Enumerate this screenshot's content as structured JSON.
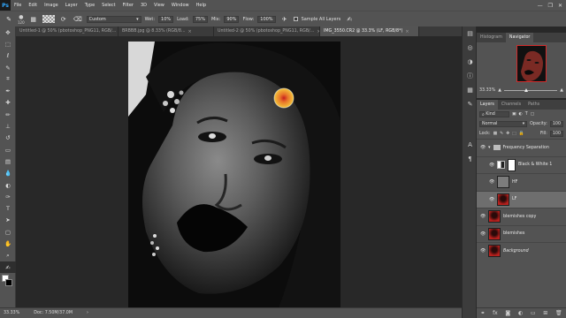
{
  "app_logo": "Ps",
  "menu": [
    "File",
    "Edit",
    "Image",
    "Layer",
    "Type",
    "Select",
    "Filter",
    "3D",
    "View",
    "Window",
    "Help"
  ],
  "window_controls": [
    "—",
    "❐",
    "✕"
  ],
  "options_bar": {
    "brush_size": "120",
    "brush_mode": "Custom",
    "wet_label": "Wet:",
    "wet_value": "10%",
    "load_label": "Load:",
    "load_value": "75%",
    "mix_label": "Mix:",
    "mix_value": "90%",
    "flow_label": "Flow:",
    "flow_value": "100%",
    "sample_all_layers": "Sample All Layers"
  },
  "tabs": [
    {
      "label": "Untitled-1 @ 50% (pbotoshop_PNG11, RGB/...",
      "active": false
    },
    {
      "label": "BRBBB.jpg @ 8.33% (RGB/8...",
      "active": false
    },
    {
      "label": "Untitled-2 @ 50% (pbotoshop_PNG11, RGB/...",
      "active": false
    },
    {
      "label": "IMG_3550.CR2 @ 33.3% (LF, RGB/8*)",
      "active": true
    }
  ],
  "tab_close": "×",
  "status": {
    "zoom": "33.33%",
    "doc": "Doc: 7.50M/37.0M",
    "arrow": "›"
  },
  "colors": {
    "foreground": "#ffffff",
    "background": "#000000",
    "accent": "#d12b2b",
    "panel": "#535353"
  },
  "navigator": {
    "tabs": [
      "Histogram",
      "Navigator"
    ],
    "active": "Navigator",
    "zoom": "33.33%"
  },
  "layers_panel": {
    "tabs": [
      "Layers",
      "Channels",
      "Paths"
    ],
    "kind": "Kind",
    "blend_mode": "Normal",
    "opacity_label": "Opacity:",
    "opacity_value": "100",
    "lock_label": "Lock:",
    "fill_label": "Fill:",
    "fill_value": "100",
    "layers": [
      {
        "name": "Frequency Separation",
        "type": "group",
        "selected": false
      },
      {
        "name": "Black & White 1",
        "type": "adjustment",
        "selected": false
      },
      {
        "name": "HF",
        "type": "gray",
        "selected": false
      },
      {
        "name": "LF",
        "type": "photo",
        "selected": true
      },
      {
        "name": "blemishes copy",
        "type": "photo",
        "selected": false
      },
      {
        "name": "blemishes",
        "type": "photo",
        "selected": false
      },
      {
        "name": "Background",
        "type": "photo",
        "selected": false
      }
    ]
  },
  "tools": [
    "move-icon",
    "marquee-icon",
    "lasso-icon",
    "quick-select-icon",
    "crop-icon",
    "eyedropper-icon",
    "healing-icon",
    "brush-icon",
    "stamp-icon",
    "history-brush-icon",
    "eraser-icon",
    "gradient-icon",
    "blur-icon",
    "dodge-icon",
    "pen-icon",
    "type-icon",
    "path-select-icon",
    "shape-icon",
    "hand-icon",
    "zoom-icon",
    "mixer-brush-icon"
  ]
}
